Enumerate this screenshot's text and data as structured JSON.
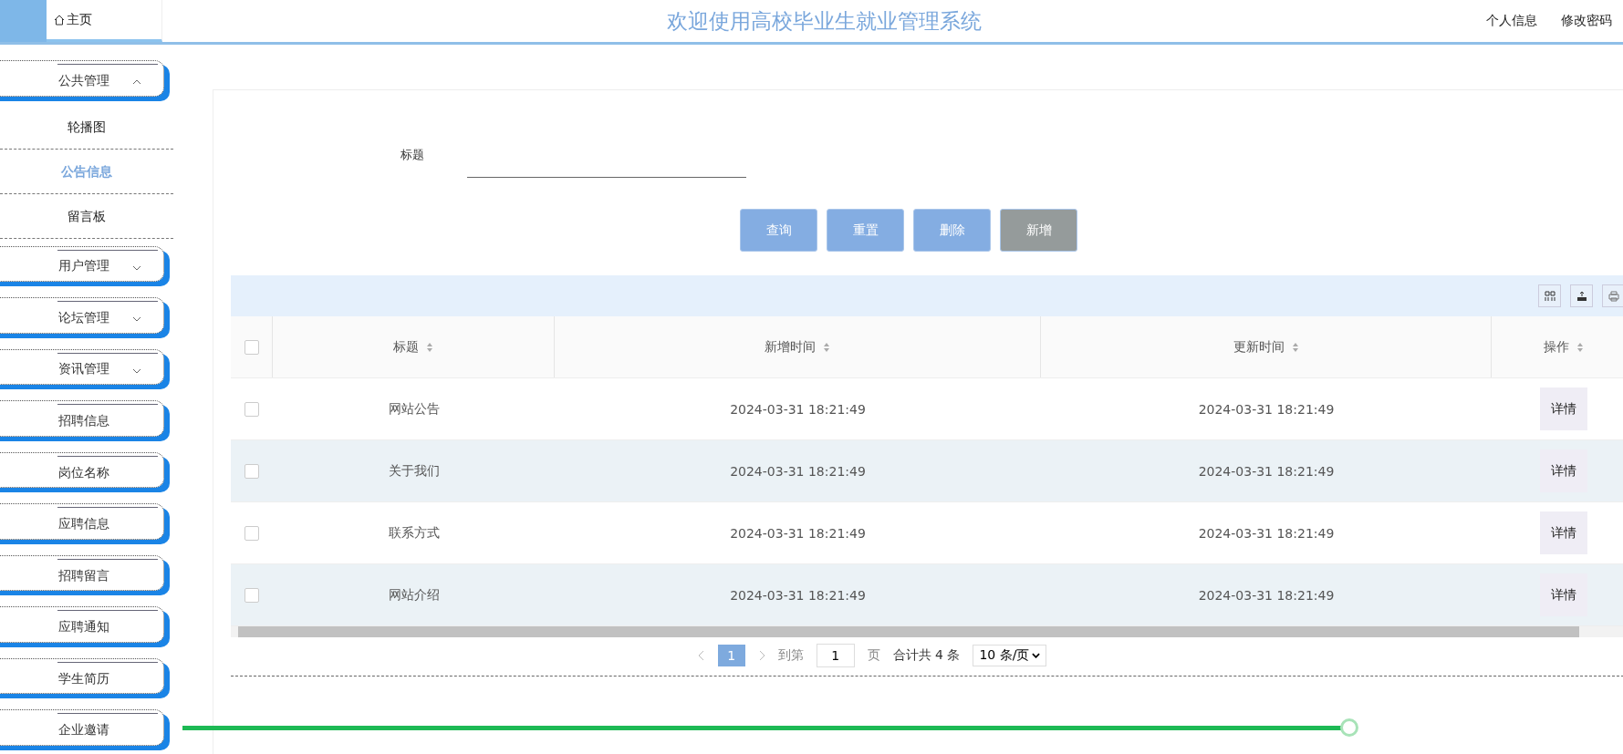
{
  "top_bar": {
    "home_tab": "主页",
    "title": "欢迎使用高校毕业生就业管理系统",
    "links": [
      "个人信息",
      "修改密码"
    ]
  },
  "sidebar": {
    "items": [
      {
        "label": "公共管理",
        "kind": "group",
        "expanded": true,
        "children": [
          {
            "label": "轮播图",
            "selected": false
          },
          {
            "label": "公告信息",
            "selected": true
          },
          {
            "label": "留言板",
            "selected": false
          }
        ]
      },
      {
        "label": "用户管理",
        "kind": "group",
        "expanded": false
      },
      {
        "label": "论坛管理",
        "kind": "group",
        "expanded": false
      },
      {
        "label": "资讯管理",
        "kind": "group",
        "expanded": false
      },
      {
        "label": "招聘信息",
        "kind": "link"
      },
      {
        "label": "岗位名称",
        "kind": "link"
      },
      {
        "label": "应聘信息",
        "kind": "link"
      },
      {
        "label": "招聘留言",
        "kind": "link"
      },
      {
        "label": "应聘通知",
        "kind": "link"
      },
      {
        "label": "学生简历",
        "kind": "link"
      },
      {
        "label": "企业邀请",
        "kind": "link"
      }
    ]
  },
  "search": {
    "label": "标题"
  },
  "actions": [
    {
      "label": "查询",
      "kind": "primary"
    },
    {
      "label": "重置",
      "kind": "primary"
    },
    {
      "label": "删除",
      "kind": "primary"
    },
    {
      "label": "新增",
      "kind": "muted"
    }
  ],
  "table": {
    "select_all_checked": false,
    "columns": [
      "标题",
      "新增时间",
      "更新时间",
      "操作"
    ],
    "rows": [
      {
        "checked": false,
        "cells": [
          "网站公告",
          "2024-03-31 18:21:49",
          "2024-03-31 18:21:49"
        ],
        "action": "详情"
      },
      {
        "checked": false,
        "cells": [
          "关于我们",
          "2024-03-31 18:21:49",
          "2024-03-31 18:21:49"
        ],
        "action": "详情"
      },
      {
        "checked": false,
        "cells": [
          "联系方式",
          "2024-03-31 18:21:49",
          "2024-03-31 18:21:49"
        ],
        "action": "详情"
      },
      {
        "checked": false,
        "cells": [
          "网站介绍",
          "2024-03-31 18:21:49",
          "2024-03-31 18:21:49"
        ],
        "action": "详情"
      }
    ]
  },
  "pagination": {
    "pages": [
      {
        "label": "1",
        "selected": true
      }
    ],
    "goto_label": "到第",
    "goto_value": "1",
    "page_unit": "页",
    "total": "合计共 4 条",
    "page_size": "10 条/页"
  },
  "video_player": {
    "level": 0.81
  }
}
